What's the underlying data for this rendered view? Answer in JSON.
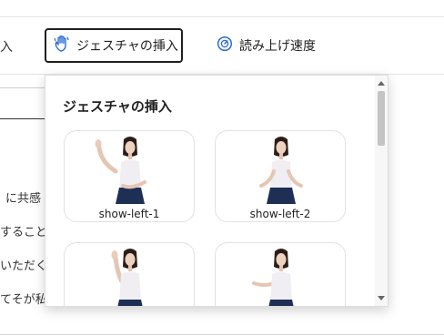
{
  "toolbar": {
    "partial_label": "入",
    "gesture_label": "ジェスチャの挿入",
    "speed_label": "読み上げ速度"
  },
  "background_text": [
    "に共感",
    "することで",
    "いただく",
    "てそが私"
  ],
  "panel": {
    "title": "ジェスチャの挿入",
    "cards": [
      {
        "caption": "show-left-1"
      },
      {
        "caption": "show-left-2"
      },
      {
        "caption": ""
      },
      {
        "caption": ""
      }
    ]
  },
  "colors": {
    "accent": "#2a6bd6",
    "border_dark": "#1f1f1f",
    "shirt": "#f0eef2",
    "skirt": "#1d2f55"
  },
  "icons": {
    "gesture": "hand-wave-icon",
    "speed": "speedometer-icon"
  }
}
